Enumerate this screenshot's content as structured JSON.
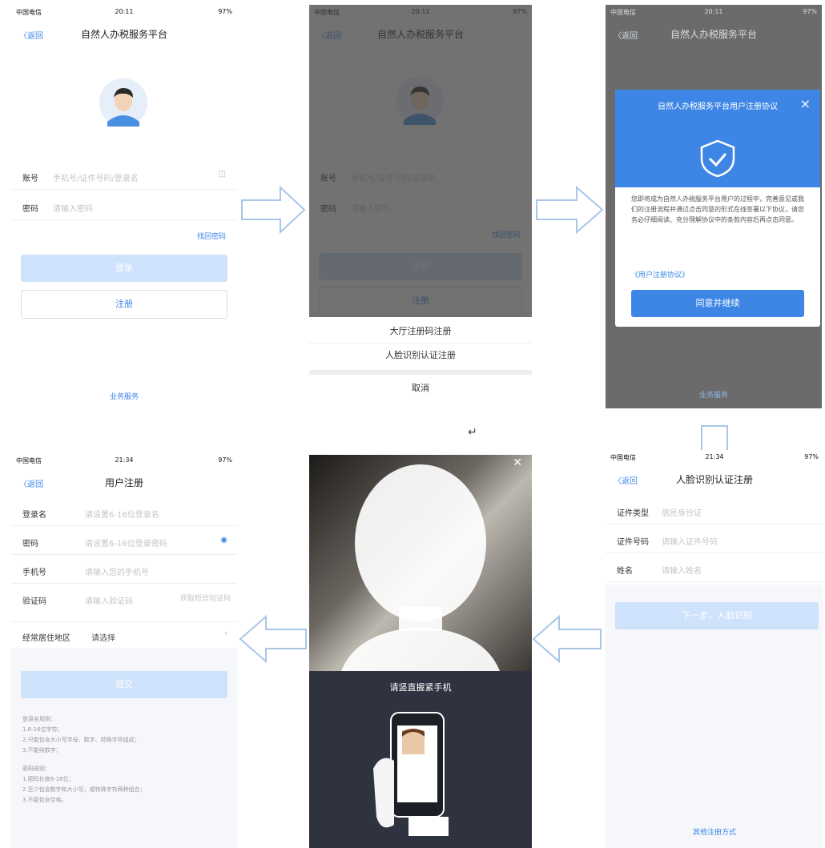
{
  "status": {
    "carrier": "中国电信",
    "time_a": "20:11",
    "time_b": "21:34",
    "battery": "97%"
  },
  "nav": {
    "back": "〈返回"
  },
  "login": {
    "title": "自然人办税服务平台",
    "account_label": "账号",
    "account_placeholder": "手机号/证件号码/登录名",
    "password_label": "密码",
    "password_placeholder": "请输入密码",
    "forgot": "找回密码",
    "login_btn": "登录",
    "register_btn": "注册",
    "footer_link": "业务服务"
  },
  "sheet": {
    "option_hall": "大厅注册码注册",
    "option_face": "人脸识别认证注册",
    "cancel": "取消"
  },
  "modal": {
    "title": "自然人办税服务平台用户注册协议",
    "body": "您即将成为自然人办税服务平台用户的过程中，完善意见或我们的注册流程并通过点击同意的形式在线签署以下协议，请您务必仔细阅读、充分理解协议中的条款内容后再点击同意。",
    "agreement_link": "《用户注册协议》",
    "agree_btn": "同意并继续",
    "footer": "业务服务"
  },
  "face_form": {
    "title": "人脸识别认证注册",
    "id_type_label": "证件类型",
    "id_type_value": "居民身份证",
    "id_number_label": "证件号码",
    "id_number_placeholder": "请输入证件号码",
    "name_label": "姓名",
    "name_placeholder": "请输入姓名",
    "next_btn": "下一步，人脸识别",
    "other_method": "其他注册方式"
  },
  "camera": {
    "hint": "请竖直握紧手机",
    "close": "✕"
  },
  "user_reg": {
    "title": "用户注册",
    "username_label": "登录名",
    "username_placeholder": "请设置6-16位登录名",
    "password_label": "密码",
    "password_placeholder": "请设置6-16位登录密码",
    "phone_label": "手机号",
    "phone_placeholder": "请输入您的手机号",
    "code_label": "验证码",
    "code_placeholder": "请输入验证码",
    "code_btn": "获取短信验证码",
    "region_label": "经常居住地区",
    "region_value": "请选择",
    "submit_btn": "提交",
    "tips_title": "登录名规则：",
    "tips_1": "1.6-16位字符；",
    "tips_2": "2.只能包含大小写字母、数字、特殊字符组成；",
    "tips_3": "3.不能纯数字；",
    "tips_title2": "密码规则：",
    "tips_4": "1.密码长度8-16位；",
    "tips_5": "2.至少包含数字和大小写，或特殊字符两种组合；",
    "tips_6": "3.不能包含空格。"
  },
  "misc": {
    "return_glyph": "↵"
  }
}
